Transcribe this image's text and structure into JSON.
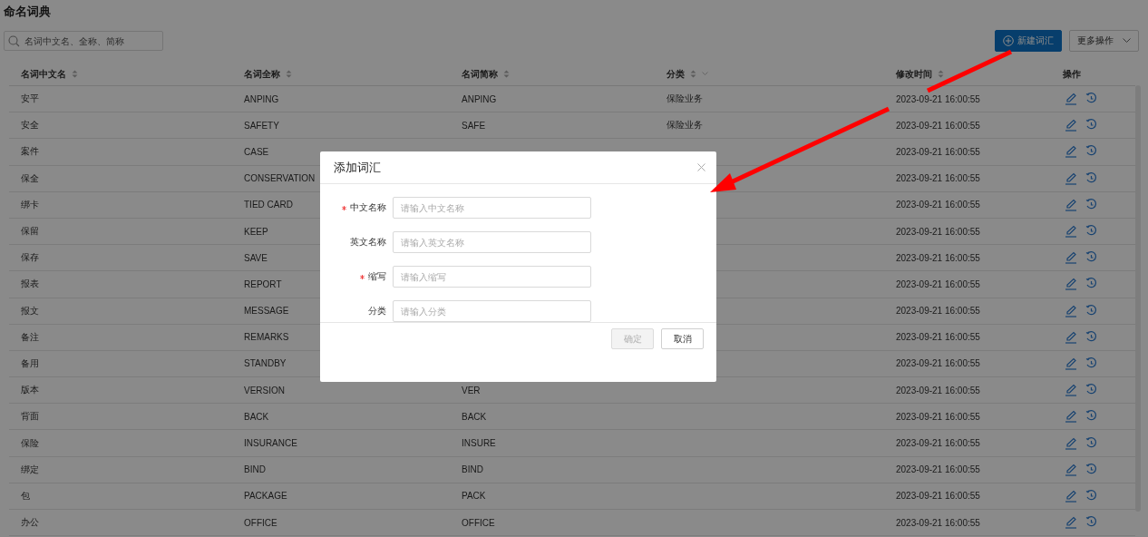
{
  "page": {
    "title": "命名词典",
    "search": {
      "placeholder": "名词中文名、全称、简称"
    },
    "buttons": [
      {
        "label": "新建词汇",
        "kind": "primary"
      },
      {
        "label": "更多操作",
        "kind": "dropdown"
      }
    ]
  },
  "table": {
    "columns": [
      {
        "label": "名词中文名",
        "kind": "sort"
      },
      {
        "label": "名词全称",
        "kind": "sort"
      },
      {
        "label": "名词简称",
        "kind": "sort"
      },
      {
        "label": "分类",
        "kind": "filter"
      },
      {
        "label": "修改时间",
        "kind": "sort"
      },
      {
        "label": "操作",
        "kind": "plain"
      }
    ],
    "rows": [
      {
        "name": "安平",
        "full": "ANPING",
        "short": "ANPING",
        "category": "保险业务",
        "time": "2023-09-21 16:00:55"
      },
      {
        "name": "安全",
        "full": "SAFETY",
        "short": "SAFE",
        "category": "保险业务",
        "time": "2023-09-21 16:00:55"
      },
      {
        "name": "案件",
        "full": "CASE",
        "time": "2023-09-21 16:00:55"
      },
      {
        "name": "保全",
        "full": "CONSERVATION",
        "time": "2023-09-21 16:00:55"
      },
      {
        "name": "绑卡",
        "full": "TIED CARD",
        "time": "2023-09-21 16:00:55"
      },
      {
        "name": "保留",
        "full": "KEEP",
        "time": "2023-09-21 16:00:55"
      },
      {
        "name": "保存",
        "full": "SAVE",
        "time": "2023-09-21 16:00:55"
      },
      {
        "name": "报表",
        "full": "REPORT",
        "time": "2023-09-21 16:00:55"
      },
      {
        "name": "报文",
        "full": "MESSAGE",
        "time": "2023-09-21 16:00:55"
      },
      {
        "name": "备注",
        "full": "REMARKS",
        "time": "2023-09-21 16:00:55"
      },
      {
        "name": "备用",
        "full": "STANDBY",
        "time": "2023-09-21 16:00:55"
      },
      {
        "name": "版本",
        "full": "VERSION",
        "short": "VER",
        "time": "2023-09-21 16:00:55"
      },
      {
        "name": "背面",
        "full": "BACK",
        "short": "BACK",
        "time": "2023-09-21 16:00:55"
      },
      {
        "name": "保险",
        "full": "INSURANCE",
        "short": "INSURE",
        "time": "2023-09-21 16:00:55"
      },
      {
        "name": "绑定",
        "full": "BIND",
        "short": "BIND",
        "time": "2023-09-21 16:00:55"
      },
      {
        "name": "包",
        "full": "PACKAGE",
        "short": "PACK",
        "time": "2023-09-21 16:00:55"
      },
      {
        "name": "办公",
        "full": "OFFICE",
        "short": "OFFICE",
        "time": "2023-09-21 16:00:55"
      }
    ]
  },
  "dialog": {
    "title": "添加词汇",
    "fields": [
      {
        "label": "中文名称",
        "required": true,
        "placeholder": "请输入中文名称"
      },
      {
        "label": "英文名称",
        "required": false,
        "placeholder": "请输入英文名称"
      },
      {
        "label": "缩写",
        "required": true,
        "placeholder": "请输入缩写"
      },
      {
        "label": "分类",
        "required": false,
        "placeholder": "请输入分类"
      }
    ],
    "buttons": [
      {
        "label": "确定",
        "disabled": true
      },
      {
        "label": "取消",
        "disabled": false
      }
    ]
  }
}
